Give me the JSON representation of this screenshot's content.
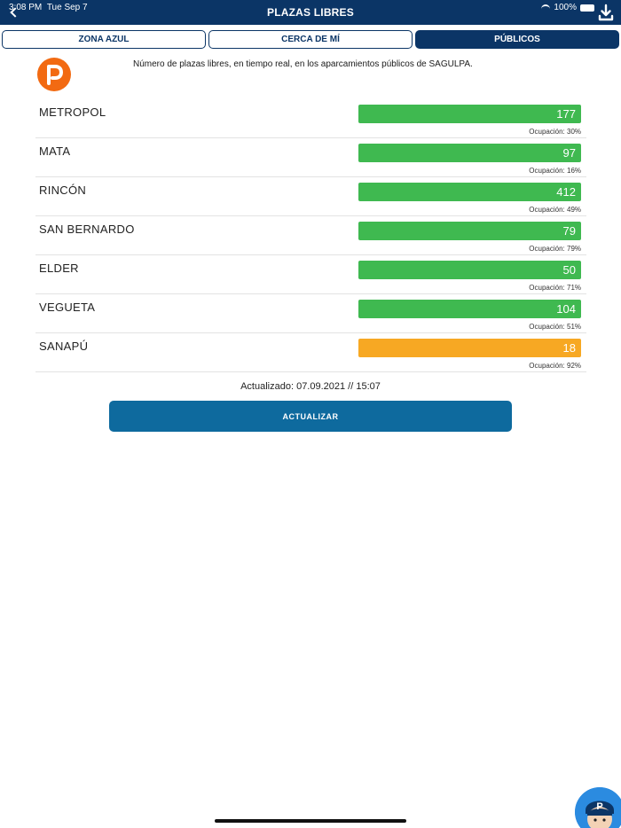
{
  "status_bar": {
    "time": "3:08 PM",
    "date": "Tue Sep 7",
    "battery": "100%"
  },
  "nav": {
    "title": "PLAZAS LIBRES",
    "back_icon": "chevron-left-icon",
    "download_icon": "download-icon"
  },
  "tabs": [
    {
      "label": "ZONA AZUL",
      "active": false
    },
    {
      "label": "CERCA DE MÍ",
      "active": false
    },
    {
      "label": "PÚBLICOS",
      "active": true
    }
  ],
  "intro": "Número de plazas libres, en tiempo real, en los aparcamientos públicos de SAGULPA.",
  "parkings": [
    {
      "name": "METROPOL",
      "free": "177",
      "occupancy": "Ocupación: 30%",
      "status": "green"
    },
    {
      "name": "MATA",
      "free": "97",
      "occupancy": "Ocupación: 16%",
      "status": "green"
    },
    {
      "name": "RINCÓN",
      "free": "412",
      "occupancy": "Ocupación: 49%",
      "status": "green"
    },
    {
      "name": "SAN BERNARDO",
      "free": "79",
      "occupancy": "Ocupación: 79%",
      "status": "green"
    },
    {
      "name": "ELDER",
      "free": "50",
      "occupancy": "Ocupación: 71%",
      "status": "green"
    },
    {
      "name": "VEGUETA",
      "free": "104",
      "occupancy": "Ocupación: 51%",
      "status": "green"
    },
    {
      "name": "SANAPÚ",
      "free": "18",
      "occupancy": "Ocupación: 92%",
      "status": "orange"
    }
  ],
  "updated": "Actualizado: 07.09.2021 // 15:07",
  "refresh_label": "ACTUALIZAR",
  "colors": {
    "nav": "#0b3566",
    "green": "#3fb950",
    "orange": "#f7a823",
    "button": "#0e6a9e",
    "logo": "#f26a12"
  }
}
